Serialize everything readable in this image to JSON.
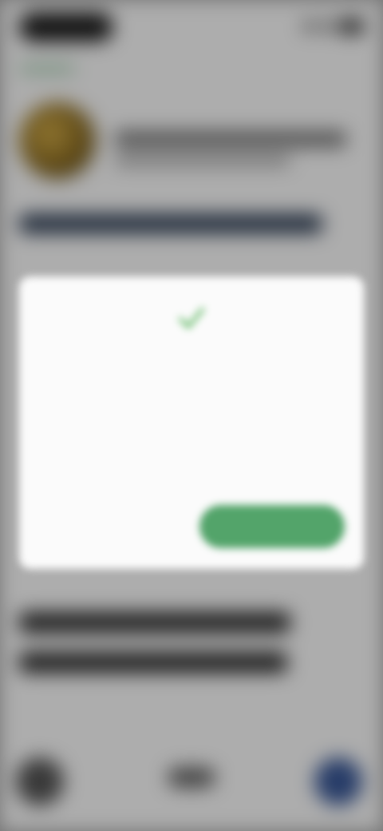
{
  "status_bar": {
    "time": "",
    "icons": [
      "signal-icon",
      "wifi-icon",
      "battery-icon"
    ]
  },
  "author": {
    "name": "",
    "subtitle": ""
  },
  "post": {
    "title": "",
    "body_lines": [
      "",
      ""
    ],
    "highlight": ""
  },
  "dialog": {
    "icon": "check-icon",
    "title": "",
    "text_1": "",
    "text_2": "",
    "secondary_label": "",
    "primary_label": ""
  },
  "bottom_nav": {
    "items": [
      "",
      "",
      ""
    ]
  },
  "colors": {
    "accent_green": "#53a46a",
    "check_green": "#4caf50",
    "nav_blue": "#3b5a9a",
    "overlay": "rgba(0,0,0,0.32)"
  }
}
